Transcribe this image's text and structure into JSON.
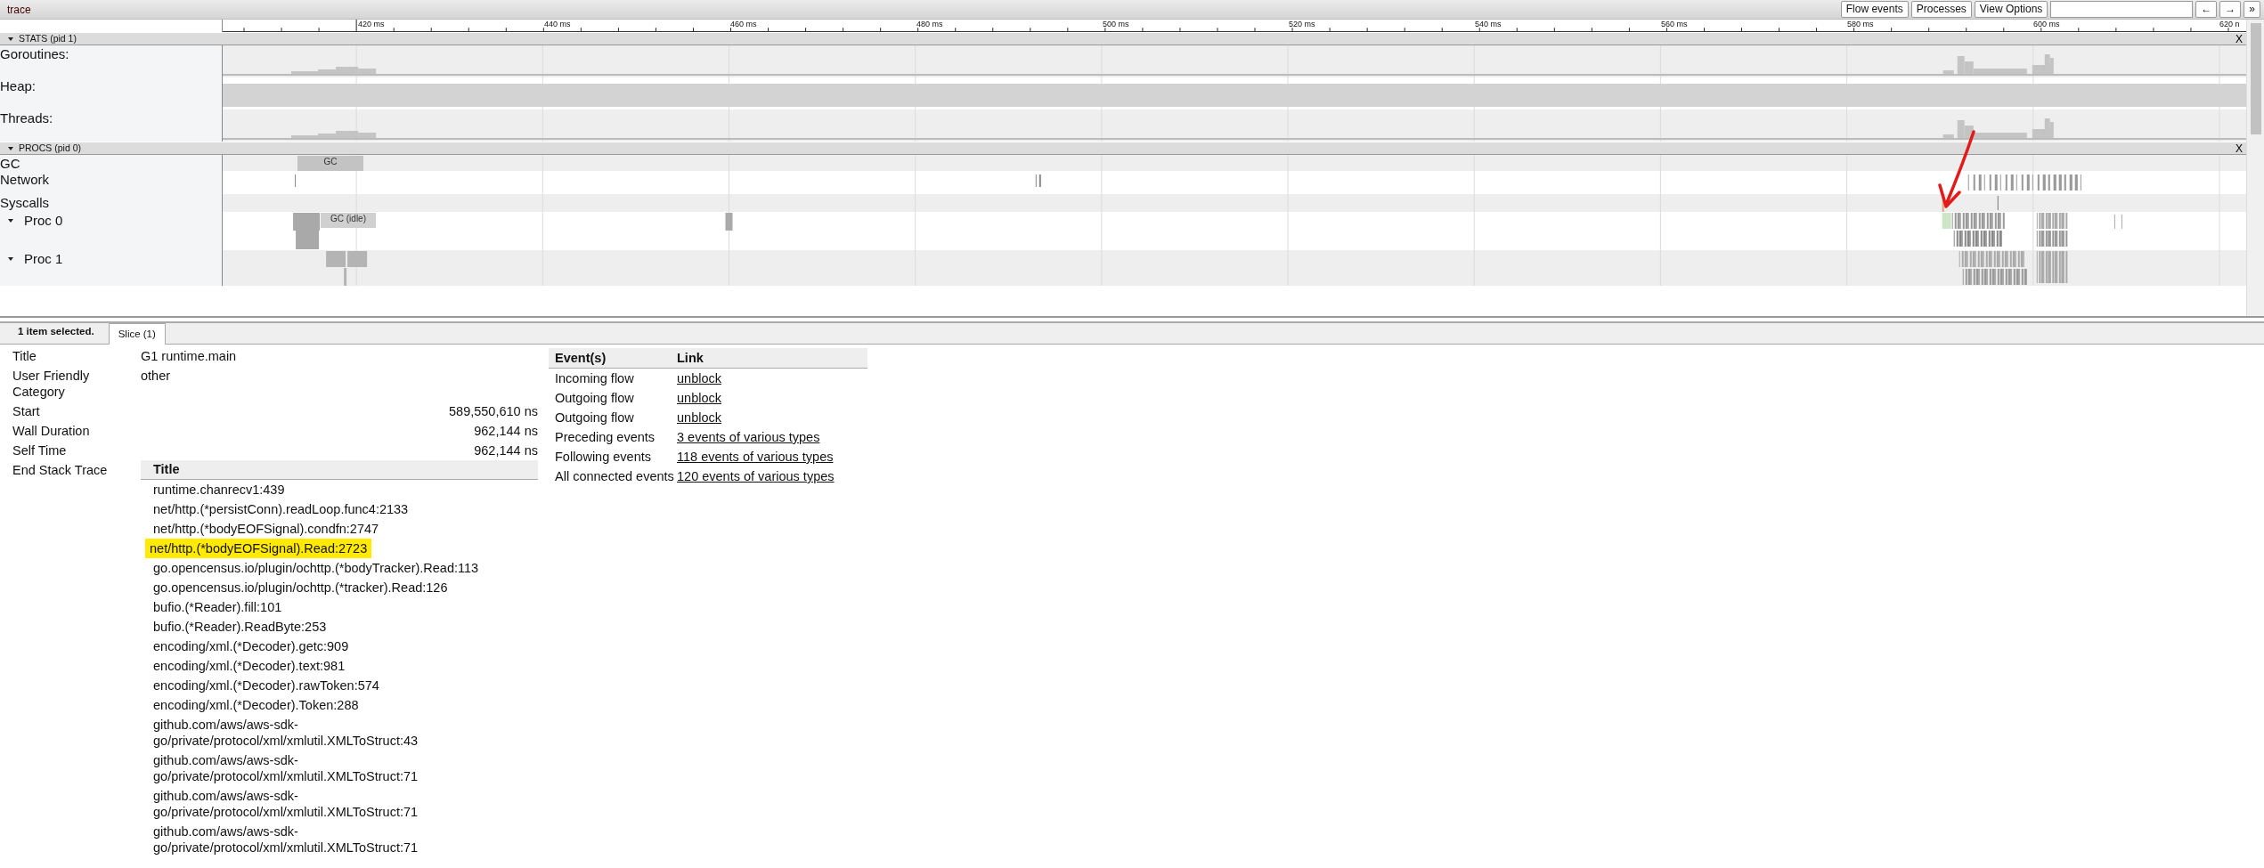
{
  "window": {
    "title": "trace"
  },
  "toolbar": {
    "buttons": [
      "Flow events",
      "Processes",
      "View Options"
    ],
    "nav_buttons": [
      "←",
      "→",
      "»"
    ]
  },
  "ruler": {
    "ticks": [
      "420 ms",
      "440 ms",
      "460 ms",
      "480 ms",
      "500 ms",
      "520 ms",
      "540 ms",
      "560 ms",
      "580 ms",
      "600 ms",
      "620 n"
    ]
  },
  "sections": [
    {
      "title": "STATS (pid 1)",
      "expanded": true,
      "close": "X",
      "tracks": [
        {
          "label": "Goroutines:",
          "kind": "counter"
        },
        {
          "label": "Heap:",
          "kind": "band"
        },
        {
          "label": "Threads:",
          "kind": "counter"
        }
      ]
    },
    {
      "title": "PROCS (pid 0)",
      "expanded": true,
      "close": "X",
      "tracks": [
        {
          "label": "GC",
          "kind": "gc",
          "slice_label": "GC"
        },
        {
          "label": "Network",
          "kind": "network"
        },
        {
          "label": "Syscalls",
          "kind": "syscalls"
        },
        {
          "label": "Proc 0",
          "kind": "proc0",
          "expanded": true,
          "slice_label": "GC (idle)"
        },
        {
          "label": "Proc 1",
          "kind": "proc1",
          "expanded": true
        }
      ]
    }
  ],
  "panel": {
    "selection_info": "1 item selected.",
    "tabs": [
      {
        "label": "Slice (1)",
        "selected": true
      }
    ],
    "fields": [
      {
        "label": "Title",
        "value": "G1 runtime.main"
      },
      {
        "label": "User Friendly Category",
        "value": "other"
      }
    ],
    "timings": [
      {
        "label": "Start",
        "value": "589,550,610 ns"
      },
      {
        "label": "Wall Duration",
        "value": "962,144 ns"
      },
      {
        "label": "Self Time",
        "value": "962,144 ns"
      }
    ],
    "stack_trace": {
      "label": "End Stack Trace",
      "column": "Title",
      "frames": [
        {
          "text": "runtime.chanrecv1:439",
          "highlighted": false
        },
        {
          "text": "net/http.(*persistConn).readLoop.func4:2133",
          "highlighted": false
        },
        {
          "text": "net/http.(*bodyEOFSignal).condfn:2747",
          "highlighted": false
        },
        {
          "text": "net/http.(*bodyEOFSignal).Read:2723",
          "highlighted": true
        },
        {
          "text": "go.opencensus.io/plugin/ochttp.(*bodyTracker).Read:113",
          "highlighted": false
        },
        {
          "text": "go.opencensus.io/plugin/ochttp.(*tracker).Read:126",
          "highlighted": false
        },
        {
          "text": "bufio.(*Reader).fill:101",
          "highlighted": false
        },
        {
          "text": "bufio.(*Reader).ReadByte:253",
          "highlighted": false
        },
        {
          "text": "encoding/xml.(*Decoder).getc:909",
          "highlighted": false
        },
        {
          "text": "encoding/xml.(*Decoder).text:981",
          "highlighted": false
        },
        {
          "text": "encoding/xml.(*Decoder).rawToken:574",
          "highlighted": false
        },
        {
          "text": "encoding/xml.(*Decoder).Token:288",
          "highlighted": false
        },
        {
          "text": "github.com/aws/aws-sdk-go/private/protocol/xml/xmlutil.XMLToStruct:43",
          "highlighted": false
        },
        {
          "text": "github.com/aws/aws-sdk-go/private/protocol/xml/xmlutil.XMLToStruct:71",
          "highlighted": false
        },
        {
          "text": "github.com/aws/aws-sdk-go/private/protocol/xml/xmlutil.XMLToStruct:71",
          "highlighted": false
        },
        {
          "text": "github.com/aws/aws-sdk-go/private/protocol/xml/xmlutil.XMLToStruct:71",
          "highlighted": false
        }
      ]
    },
    "events": {
      "columns": [
        "Event(s)",
        "Link"
      ],
      "rows": [
        {
          "event": "Incoming flow",
          "link": "unblock"
        },
        {
          "event": "Outgoing flow",
          "link": "unblock"
        },
        {
          "event": "Outgoing flow",
          "link": "unblock"
        },
        {
          "event": "Preceding events",
          "link": "3 events of various types"
        },
        {
          "event": "Following events",
          "link": "118 events of various types"
        },
        {
          "event": "All connected events",
          "link": "120 events of various types"
        }
      ]
    }
  }
}
